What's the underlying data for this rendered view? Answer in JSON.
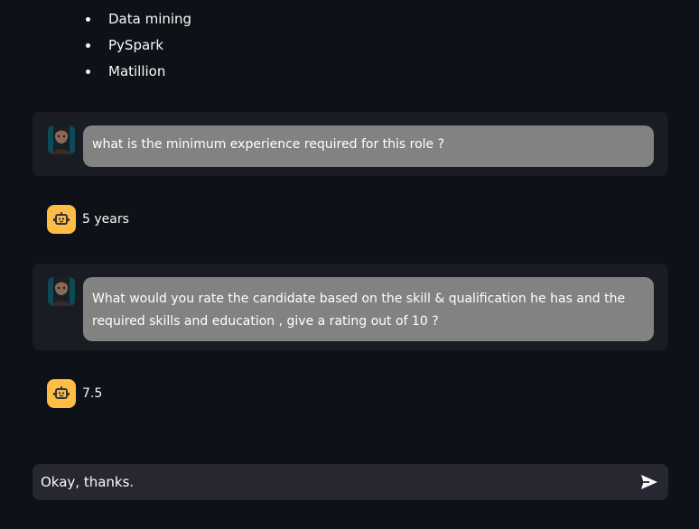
{
  "skills_list": [
    "Data mining",
    "PySpark",
    "Matillion"
  ],
  "messages": [
    {
      "role": "user",
      "text": "what is the minimum experience required for this role ?"
    },
    {
      "role": "assistant",
      "text": "5 years"
    },
    {
      "role": "user",
      "text": "What would you rate the candidate based on the skill & qualification he has and the required skills and education , give a rating out of 10 ?"
    },
    {
      "role": "assistant",
      "text": "7.5"
    }
  ],
  "chat_input": {
    "value": "Okay, thanks.",
    "send_icon": "send-icon"
  },
  "colors": {
    "background": "#0e1117",
    "user_block": "#1a1c24",
    "user_bubble": "#828282",
    "bot_avatar": "#ffbd45",
    "input_bg": "#262730"
  }
}
